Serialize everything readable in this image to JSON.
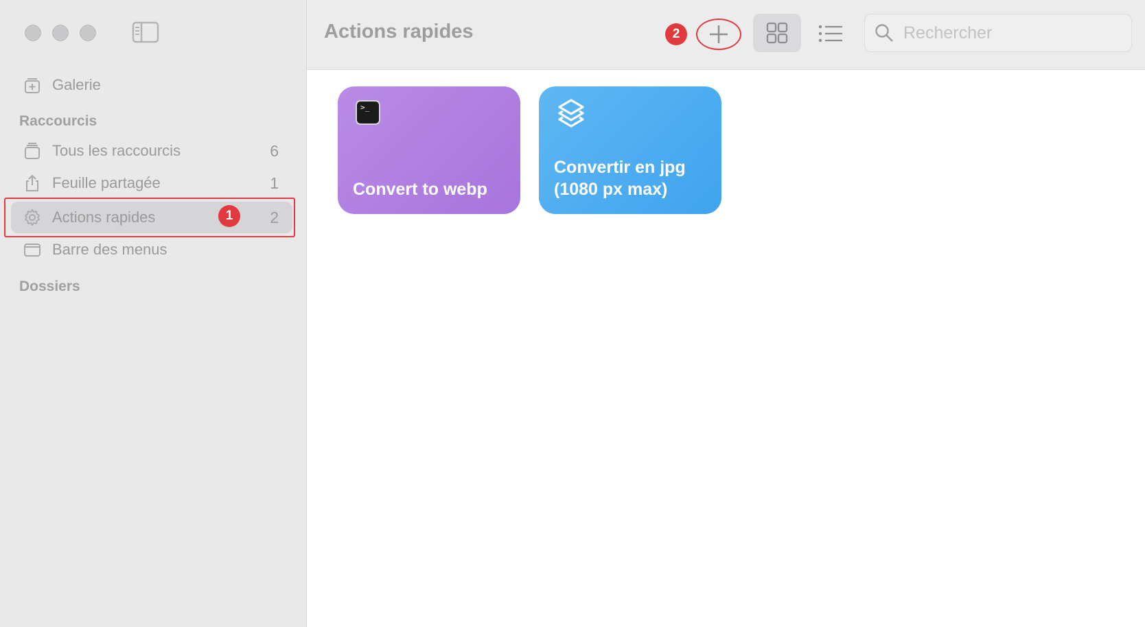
{
  "sidebar": {
    "gallery_label": "Galerie",
    "section_shortcuts": "Raccourcis",
    "items": [
      {
        "label": "Tous les raccourcis",
        "count": "6"
      },
      {
        "label": "Feuille partagée",
        "count": "1"
      },
      {
        "label": "Actions rapides",
        "count": "2"
      },
      {
        "label": "Barre des menus",
        "count": ""
      }
    ],
    "section_folders": "Dossiers"
  },
  "annotations": {
    "badge_1": "1",
    "badge_2": "2"
  },
  "toolbar": {
    "title": "Actions rapides",
    "search_placeholder": "Rechercher"
  },
  "shortcuts": [
    {
      "label": "Convert to webp",
      "icon": "terminal-icon",
      "color": "#b07ee1",
      "icon_glyph": ">_"
    },
    {
      "label": "Convertir en jpg (1080 px max)",
      "icon": "layers-icon",
      "color": "#4aabf0"
    }
  ],
  "colors": {
    "annotation_red": "#e0393e",
    "sidebar_bg": "#e9e9ea"
  }
}
